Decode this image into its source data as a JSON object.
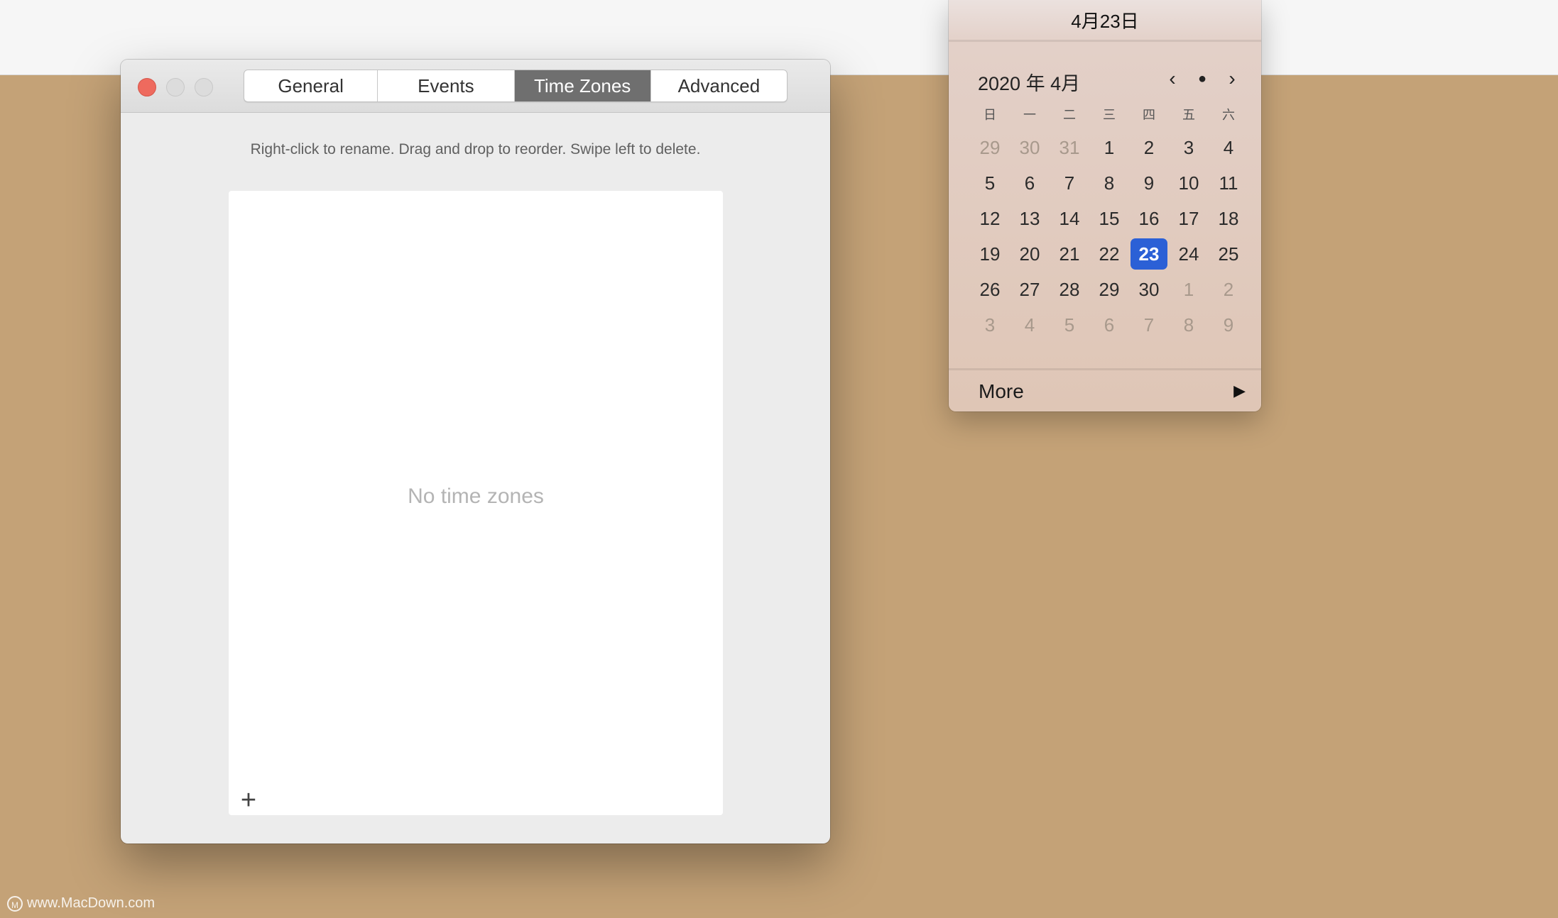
{
  "prefs": {
    "tabs": [
      {
        "label": "General",
        "active": false
      },
      {
        "label": "Events",
        "active": false
      },
      {
        "label": "Time Zones",
        "active": true
      },
      {
        "label": "Advanced",
        "active": false
      }
    ],
    "hint": "Right-click to rename. Drag and drop to reorder. Swipe left to delete.",
    "empty_text": "No time zones",
    "add_label": "+"
  },
  "calendar": {
    "header_date": "4月23日",
    "month_label": "2020 年 4月",
    "nav_prev": "‹",
    "nav_today": "●",
    "nav_next": "›",
    "weekdays": [
      "日",
      "一",
      "二",
      "三",
      "四",
      "五",
      "六"
    ],
    "days": [
      "29",
      "30",
      "31",
      "1",
      "2",
      "3",
      "4",
      "5",
      "6",
      "7",
      "8",
      "9",
      "10",
      "11",
      "12",
      "13",
      "14",
      "15",
      "16",
      "17",
      "18",
      "19",
      "20",
      "21",
      "22",
      "23",
      "24",
      "25",
      "26",
      "27",
      "28",
      "29",
      "30",
      "1",
      "2",
      "3",
      "4",
      "5",
      "6",
      "7",
      "8",
      "9"
    ],
    "muted_indices": [
      0,
      1,
      2,
      33,
      34,
      35,
      36,
      37,
      38,
      39,
      40,
      41
    ],
    "selected_index": 25,
    "more_label": "More",
    "more_arrow": "▶"
  },
  "watermark": {
    "logo": "M",
    "text": "www.MacDown.com"
  },
  "colors": {
    "desktop": "#c4a277",
    "close": "#ee6a5e",
    "selected_day": "#2b60d6",
    "active_tab": "#6f6f6f"
  }
}
